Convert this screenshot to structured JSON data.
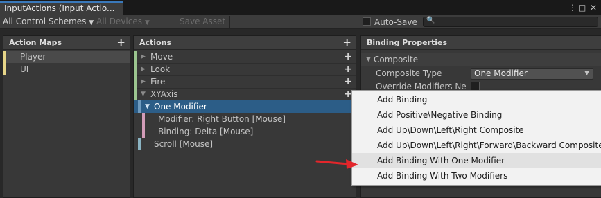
{
  "window": {
    "tab_title": "InputActions (Input Actio...",
    "menu_icon": "⋮",
    "maximize_icon": "□",
    "close_icon": "✕"
  },
  "toolbar": {
    "control_scheme": "All Control Schemes",
    "devices": "All Devices",
    "save_asset": "Save Asset",
    "autosave_label": "Auto-Save",
    "autosave_checked": false,
    "search_value": ""
  },
  "action_maps": {
    "header": "Action Maps",
    "items": [
      {
        "label": "Player",
        "selected": true
      },
      {
        "label": "UI",
        "selected": false
      }
    ]
  },
  "actions": {
    "header": "Actions",
    "items": [
      {
        "label": "Move"
      },
      {
        "label": "Look"
      },
      {
        "label": "Fire"
      },
      {
        "label": "XYAxis"
      }
    ],
    "composite": "One Modifier",
    "composite_parts": [
      "Modifier: Right Button [Mouse]",
      "Binding: Delta [Mouse]"
    ],
    "scroll_binding": "Scroll [Mouse]"
  },
  "properties": {
    "header": "Binding Properties",
    "section": "Composite",
    "composite_type_label": "Composite Type",
    "composite_type_value": "One Modifier",
    "override_label": "Override Modifiers Ne",
    "override_checked": false
  },
  "context_menu": {
    "items": [
      "Add Binding",
      "Add Positive\\Negative Binding",
      "Add Up\\Down\\Left\\Right Composite",
      "Add Up\\Down\\Left\\Right\\Forward\\Backward Composite",
      "Add Binding With One Modifier",
      "Add Binding With Two Modifiers"
    ],
    "highlighted_index": 4
  },
  "colors": {
    "accent_selection": "#2c5d87",
    "action_map_stripe": "#e6d588",
    "action_stripe": "#9bc58f",
    "binding_stripe": "#d29cb8",
    "scroll_stripe": "#8ab3c2",
    "annotation_arrow": "#e3262b"
  }
}
